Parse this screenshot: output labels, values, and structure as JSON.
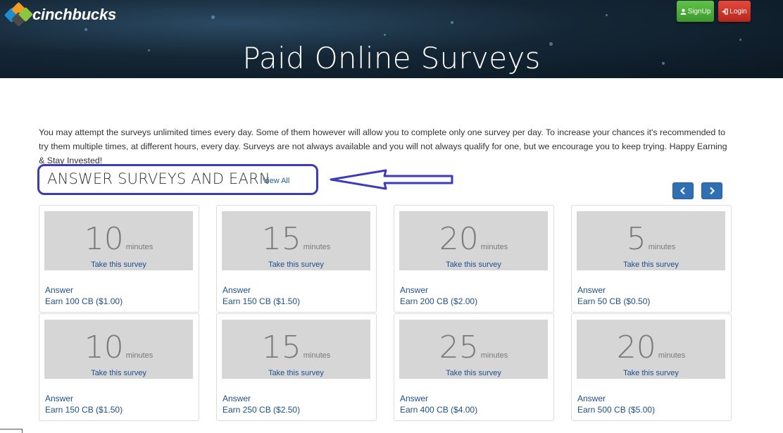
{
  "brand": {
    "name": "cinchbucks"
  },
  "header": {
    "title": "Paid Online Surveys",
    "signup_label": "SignUp",
    "login_label": "Login"
  },
  "intro": "You may attempt the surveys unlimited times every day. Some of them however will allow you to complete only one survey per day. To increase your chances it's recommended to try them multiple times, at different hours, every day. Surveys are not always available and you will not always qualify for one, but we encourage you to keep trying. Happy Earning & Stay Invested!",
  "section": {
    "title": "ANSWER SURVEYS AND EARN",
    "view_all": "View All"
  },
  "colors": {
    "accent": "#2f6fb3",
    "highlight": "#3b3bbf",
    "signup": "#4caf39",
    "login": "#d0342a",
    "tile": "#d6d6d6"
  },
  "surveys": [
    {
      "minutes": "10",
      "unit": "minutes",
      "cta": "Take this survey",
      "label": "Answer",
      "reward": "Earn 100 CB ($1.00)"
    },
    {
      "minutes": "15",
      "unit": "minutes",
      "cta": "Take this survey",
      "label": "Answer",
      "reward": "Earn 150 CB ($1.50)"
    },
    {
      "minutes": "20",
      "unit": "minutes",
      "cta": "Take this survey",
      "label": "Answer",
      "reward": "Earn 200 CB ($2.00)"
    },
    {
      "minutes": "5",
      "unit": "minutes",
      "cta": "Take this survey",
      "label": "Answer",
      "reward": "Earn 50 CB ($0.50)"
    },
    {
      "minutes": "10",
      "unit": "minutes",
      "cta": "Take this survey",
      "label": "Answer",
      "reward": "Earn 150 CB ($1.50)"
    },
    {
      "minutes": "15",
      "unit": "minutes",
      "cta": "Take this survey",
      "label": "Answer",
      "reward": "Earn 250 CB ($2.50)"
    },
    {
      "minutes": "25",
      "unit": "minutes",
      "cta": "Take this survey",
      "label": "Answer",
      "reward": "Earn 400 CB ($4.00)"
    },
    {
      "minutes": "20",
      "unit": "minutes",
      "cta": "Take this survey",
      "label": "Answer",
      "reward": "Earn 500 CB ($5.00)"
    }
  ]
}
